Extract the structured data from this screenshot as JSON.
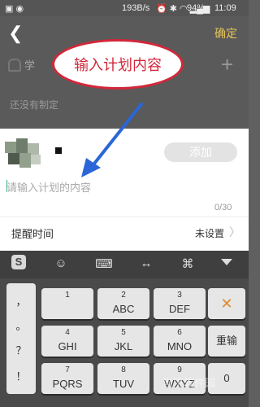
{
  "status": {
    "network_speed": "193B/s",
    "battery": "94%",
    "time": "11:09"
  },
  "header": {
    "back_icon": "chevron-left-icon",
    "confirm_label": "确定"
  },
  "background": {
    "study_label": "学",
    "empty_label": "还没有制定"
  },
  "annotation": {
    "text": "输入计划内容",
    "color": "#d3273a",
    "arrow_color": "#2a66d8"
  },
  "plan": {
    "add_label": "添加",
    "placeholder": "请输入计划的内容",
    "counter": "0/30",
    "reminder_label": "提醒时间",
    "reminder_value": "未设置"
  },
  "keyboard": {
    "toolbar_icons": [
      "sogou-logo-icon",
      "emoji-icon",
      "keyboard-icon",
      "cursor-icon",
      "command-icon",
      "hide-keyboard-icon"
    ],
    "punctuation": [
      "，",
      "。",
      "？",
      "！"
    ],
    "rows": [
      [
        {
          "num": "1",
          "letters": ""
        },
        {
          "num": "2",
          "letters": "ABC"
        },
        {
          "num": "3",
          "letters": "DEF"
        }
      ],
      [
        {
          "num": "4",
          "letters": "GHI"
        },
        {
          "num": "5",
          "letters": "JKL"
        },
        {
          "num": "6",
          "letters": "MNO"
        }
      ],
      [
        {
          "num": "7",
          "letters": "PQRS"
        },
        {
          "num": "8",
          "letters": "TUV"
        },
        {
          "num": "9",
          "letters": "WXYZ"
        }
      ]
    ],
    "delete_icon": "delete-x-icon",
    "reenter_label": "重输",
    "zero_label": "0"
  },
  "watermark": "当下软件园"
}
